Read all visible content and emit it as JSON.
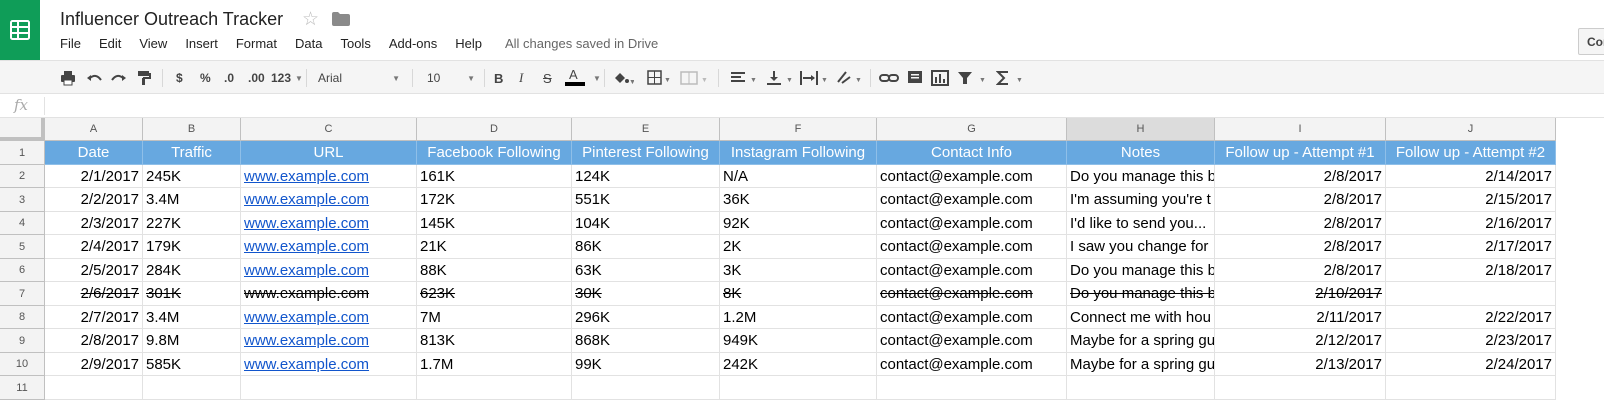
{
  "app": {
    "title": "Influencer Outreach Tracker",
    "save_status": "All changes saved in Drive",
    "comments_label": "Comments",
    "brand_color": "#0f9d58",
    "header_fill_color": "#67a8e0",
    "link_color": "#1155cc"
  },
  "menu": [
    "File",
    "Edit",
    "View",
    "Insert",
    "Format",
    "Data",
    "Tools",
    "Add-ons",
    "Help"
  ],
  "toolbar": {
    "currency": "$",
    "percent": "%",
    "decrease_decimals": ".0",
    "increase_decimals": ".00",
    "more_formats": "123",
    "font_family": "Arial",
    "font_size": "10",
    "bold": "B",
    "italic": "I",
    "strikethrough": "S",
    "text_color": "A"
  },
  "formula_bar": {
    "fx_label": "fx",
    "value": ""
  },
  "sheet": {
    "column_letters": [
      "A",
      "B",
      "C",
      "D",
      "E",
      "F",
      "G",
      "H",
      "I",
      "J"
    ],
    "row_numbers": [
      "1",
      "2",
      "3",
      "4",
      "5",
      "6",
      "7",
      "8",
      "9",
      "10",
      "11"
    ],
    "selected_column": "H",
    "headers": [
      "Date",
      "Traffic",
      "URL",
      "Facebook Following",
      "Pinterest Following",
      "Instagram Following",
      "Contact Info",
      "Notes",
      "Follow up - Attempt #1",
      "Follow up - Attempt #2"
    ],
    "rows": [
      {
        "cells": [
          "2/1/2017",
          "245K",
          "www.example.com",
          "161K",
          "124K",
          "N/A",
          "contact@example.com",
          "Do you manage this b",
          "2/8/2017",
          "2/14/2017"
        ],
        "struck": false
      },
      {
        "cells": [
          "2/2/2017",
          "3.4M",
          "www.example.com",
          "172K",
          "551K",
          "36K",
          "contact@example.com",
          "I'm assuming you're t",
          "2/8/2017",
          "2/15/2017"
        ],
        "struck": false
      },
      {
        "cells": [
          "2/3/2017",
          "227K",
          "www.example.com",
          "145K",
          "104K",
          "92K",
          "contact@example.com",
          "I'd like to send you...",
          "2/8/2017",
          "2/16/2017"
        ],
        "struck": false
      },
      {
        "cells": [
          "2/4/2017",
          "179K",
          "www.example.com",
          "21K",
          "86K",
          "2K",
          "contact@example.com",
          "I saw you change for",
          "2/8/2017",
          "2/17/2017"
        ],
        "struck": false
      },
      {
        "cells": [
          "2/5/2017",
          "284K",
          "www.example.com",
          "88K",
          "63K",
          "3K",
          "contact@example.com",
          "Do you manage this b",
          "2/8/2017",
          "2/18/2017"
        ],
        "struck": false
      },
      {
        "cells": [
          "2/6/2017",
          "301K",
          "www.example.com",
          "623K",
          "30K",
          "8K",
          "contact@example.com",
          "Do you manage this b",
          "2/10/2017",
          ""
        ],
        "struck": true
      },
      {
        "cells": [
          "2/7/2017",
          "3.4M",
          "www.example.com",
          "7M",
          "296K",
          "1.2M",
          "contact@example.com",
          "Connect me with hou",
          "2/11/2017",
          "2/22/2017"
        ],
        "struck": false
      },
      {
        "cells": [
          "2/8/2017",
          "9.8M",
          "www.example.com",
          "813K",
          "868K",
          "949K",
          "contact@example.com",
          "Maybe for a spring gu",
          "2/12/2017",
          "2/23/2017"
        ],
        "struck": false
      },
      {
        "cells": [
          "2/9/2017",
          "585K",
          "www.example.com",
          "1.7M",
          "99K",
          "242K",
          "contact@example.com",
          "Maybe for a spring gu",
          "2/13/2017",
          "2/24/2017"
        ],
        "struck": false
      },
      {
        "cells": [
          "",
          "",
          "",
          "",
          "",
          "",
          "",
          "",
          "",
          ""
        ],
        "struck": false
      }
    ]
  }
}
